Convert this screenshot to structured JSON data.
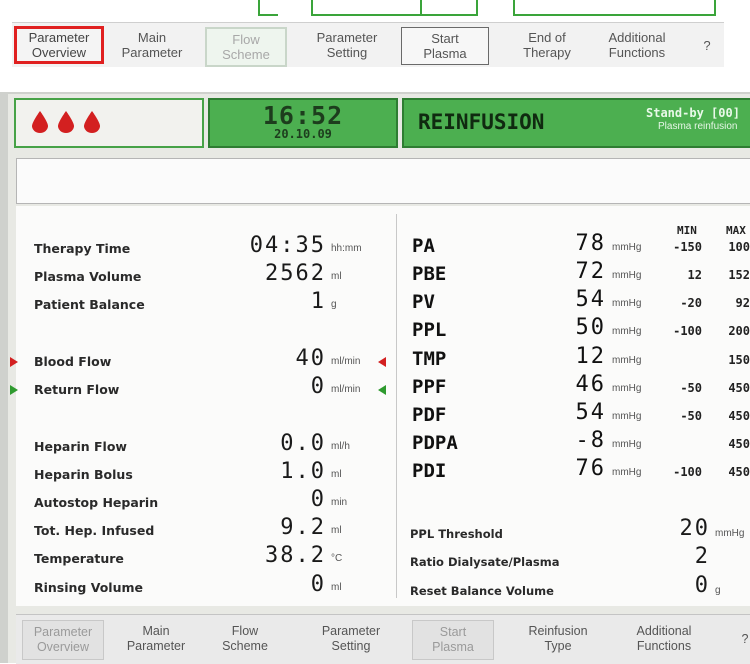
{
  "top_toolbar": {
    "items": [
      {
        "label": "Parameter\nOverview",
        "state": "selected"
      },
      {
        "label": "Main\nParameter",
        "state": "normal"
      },
      {
        "label": "Flow\nScheme",
        "state": "disabled"
      },
      {
        "label": "Parameter\nSetting",
        "state": "normal"
      },
      {
        "label": "Start\nPlasma",
        "state": "boxed"
      },
      {
        "label": "End of\nTherapy",
        "state": "normal"
      },
      {
        "label": "Additional\nFunctions",
        "state": "normal"
      },
      {
        "label": "?",
        "state": "normal"
      }
    ]
  },
  "header": {
    "blood_drops": 3,
    "time": "16:52",
    "date": "20.10.09",
    "status_title": "REINFUSION",
    "status_mode": "Stand-by [00]",
    "status_sub": "Plasma reinfusion"
  },
  "message_box": "",
  "left_params": [
    {
      "label": "Therapy Time",
      "value": "04:35",
      "unit": "hh:mm"
    },
    {
      "label": "Plasma Volume",
      "value": "2562",
      "unit": "ml"
    },
    {
      "label": "Patient Balance",
      "value": "1",
      "unit": "g"
    },
    {
      "label": "Blood Flow",
      "value": "40",
      "unit": "ml/min",
      "marker": "red"
    },
    {
      "label": "Return Flow",
      "value": "0",
      "unit": "ml/min",
      "marker": "green"
    },
    {
      "label": "Heparin Flow",
      "value": "0.0",
      "unit": "ml/h"
    },
    {
      "label": "Heparin Bolus",
      "value": "1.0",
      "unit": "ml"
    },
    {
      "label": "Autostop Heparin",
      "value": "0",
      "unit": "min"
    },
    {
      "label": "Tot. Hep. Infused",
      "value": "9.2",
      "unit": "ml"
    },
    {
      "label": "Temperature",
      "value": "38.2",
      "unit": "°C"
    },
    {
      "label": "Rinsing Volume",
      "value": "0",
      "unit": "ml"
    }
  ],
  "pressure_header": {
    "min": "MIN",
    "max": "MAX"
  },
  "pressures": [
    {
      "label": "PA",
      "value": "78",
      "unit": "mmHg",
      "min": "-150",
      "max": "100"
    },
    {
      "label": "PBE",
      "value": "72",
      "unit": "mmHg",
      "min": "12",
      "max": "152"
    },
    {
      "label": "PV",
      "value": "54",
      "unit": "mmHg",
      "min": "-20",
      "max": "92"
    },
    {
      "label": "PPL",
      "value": "50",
      "unit": "mmHg",
      "min": "-100",
      "max": "200"
    },
    {
      "label": "TMP",
      "value": "12",
      "unit": "mmHg",
      "min": "",
      "max": "150"
    },
    {
      "label": "PPF",
      "value": "46",
      "unit": "mmHg",
      "min": "-50",
      "max": "450"
    },
    {
      "label": "PDF",
      "value": "54",
      "unit": "mmHg",
      "min": "-50",
      "max": "450"
    },
    {
      "label": "PDPA",
      "value": "-8",
      "unit": "mmHg",
      "min": "",
      "max": "450"
    },
    {
      "label": "PDI",
      "value": "76",
      "unit": "mmHg",
      "min": "-100",
      "max": "450"
    }
  ],
  "right_params": [
    {
      "label": "PPL Threshold",
      "value": "20",
      "unit": "mmHg"
    },
    {
      "label": "Ratio Dialysate/Plasma",
      "value": "2",
      "unit": ""
    },
    {
      "label": "Reset Balance Volume",
      "value": "0",
      "unit": "g"
    }
  ],
  "bottom_toolbar": {
    "items": [
      {
        "label": "Parameter\nOverview",
        "state": "dim"
      },
      {
        "label": "Main\nParameter",
        "state": "normal"
      },
      {
        "label": "Flow\nScheme",
        "state": "normal"
      },
      {
        "label": "Parameter\nSetting",
        "state": "normal"
      },
      {
        "label": "Start\nPlasma",
        "state": "dim"
      },
      {
        "label": "Reinfusion\nType",
        "state": "normal"
      },
      {
        "label": "Additional\nFunctions",
        "state": "normal"
      },
      {
        "label": "?",
        "state": "normal"
      }
    ]
  },
  "colors": {
    "screen_green": "#4caf50",
    "drop_red": "#d32020",
    "selection_red": "#e02020",
    "flow_marker_green": "#2e9a2e"
  }
}
